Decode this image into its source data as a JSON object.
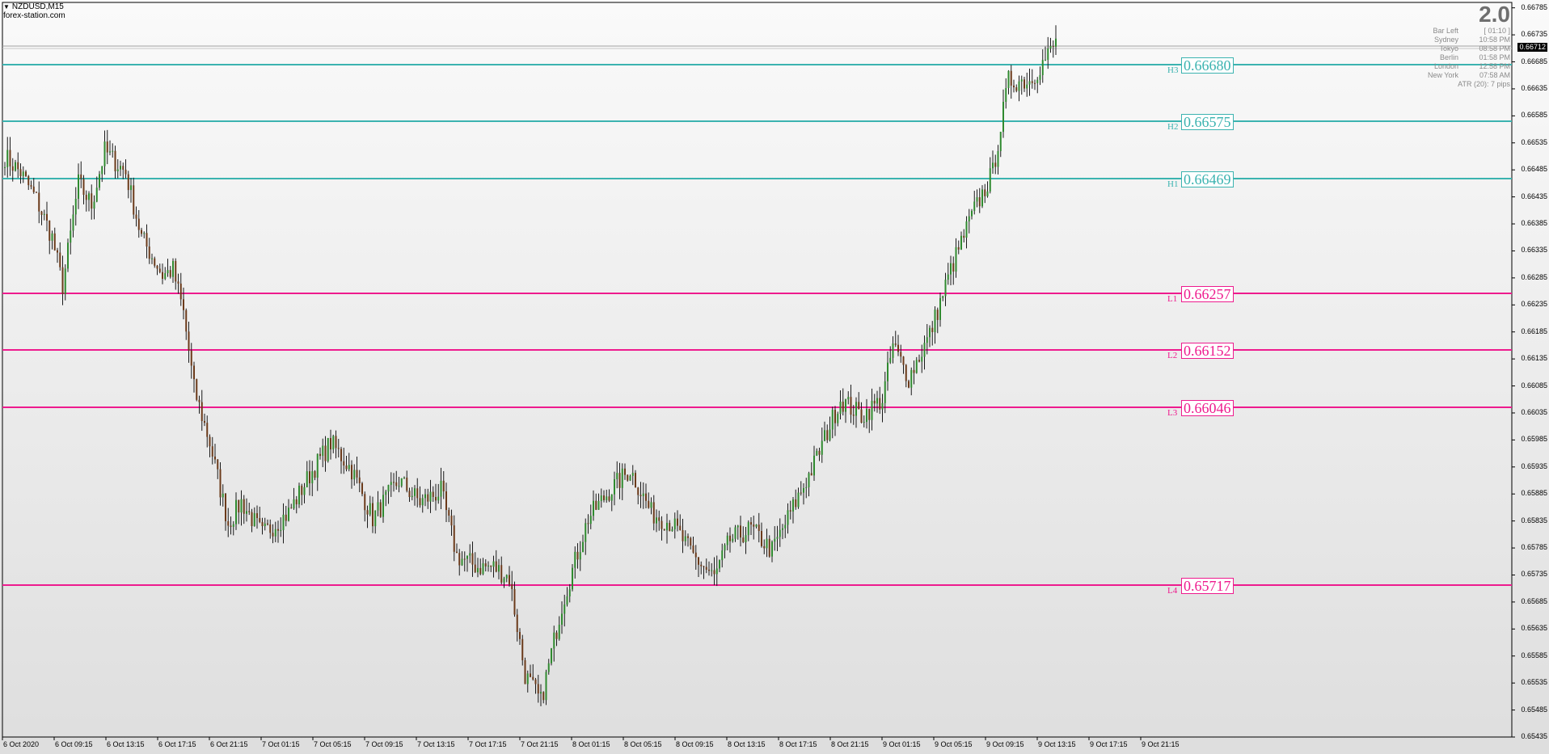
{
  "window": {
    "symbol": "NZDUSD,M15",
    "watermark": "forex-station.com"
  },
  "info_panel": {
    "version": "2.0",
    "rows": [
      {
        "label": "Bar Left",
        "value": "[ 01:10 ]"
      },
      {
        "label": "Sydney",
        "value": "10:58 PM"
      },
      {
        "label": "Tokyo",
        "value": "08:58 PM"
      },
      {
        "label": "Berlin",
        "value": "01:58 PM"
      },
      {
        "label": "London",
        "value": "12:58 PM"
      },
      {
        "label": "New York",
        "value": "07:58 AM"
      }
    ],
    "atr": "ATR (20): 7 pips"
  },
  "levels": [
    {
      "tag": "H3",
      "value": 0.6668,
      "text": "0.66680",
      "kind": "high"
    },
    {
      "tag": "H2",
      "value": 0.66575,
      "text": "0.66575",
      "kind": "high"
    },
    {
      "tag": "H1",
      "value": 0.66469,
      "text": "0.66469",
      "kind": "high"
    },
    {
      "tag": "L1",
      "value": 0.66257,
      "text": "0.66257",
      "kind": "low"
    },
    {
      "tag": "L2",
      "value": 0.66152,
      "text": "0.66152",
      "kind": "low"
    },
    {
      "tag": "L3",
      "value": 0.66046,
      "text": "0.66046",
      "kind": "low"
    },
    {
      "tag": "L4",
      "value": 0.65717,
      "text": "0.65717",
      "kind": "low"
    }
  ],
  "colors": {
    "high": "#3bb3b0",
    "low": "#ee1b8e",
    "bull": "#2f8a2f",
    "bear": "#6b3a1a",
    "wick": "#1a1a1a",
    "grid": "#a0a0a0"
  },
  "price_axis": {
    "ticks": [
      "0.66785",
      "0.66735",
      "0.66685",
      "0.66635",
      "0.66585",
      "0.66535",
      "0.66485",
      "0.66435",
      "0.66385",
      "0.66335",
      "0.66285",
      "0.66235",
      "0.66185",
      "0.66135",
      "0.66085",
      "0.66035",
      "0.65985",
      "0.65935",
      "0.65885",
      "0.65835",
      "0.65785",
      "0.65735",
      "0.65685",
      "0.65635",
      "0.65585",
      "0.65535",
      "0.65485",
      "0.65435"
    ],
    "current_price": "0.66712"
  },
  "time_axis": {
    "labels": [
      "6 Oct 2020",
      "6 Oct 09:15",
      "6 Oct 13:15",
      "6 Oct 17:15",
      "6 Oct 21:15",
      "7 Oct 01:15",
      "7 Oct 05:15",
      "7 Oct 09:15",
      "7 Oct 13:15",
      "7 Oct 17:15",
      "7 Oct 21:15",
      "8 Oct 01:15",
      "8 Oct 05:15",
      "8 Oct 09:15",
      "8 Oct 13:15",
      "8 Oct 17:15",
      "8 Oct 21:15",
      "9 Oct 01:15",
      "9 Oct 05:15",
      "9 Oct 09:15",
      "9 Oct 13:15",
      "9 Oct 17:15",
      "9 Oct 21:15"
    ]
  },
  "chart_data": {
    "type": "candlestick",
    "symbol": "NZDUSD",
    "timeframe": "M15",
    "ylim": [
      0.65435,
      0.66795
    ],
    "anchors": [
      [
        0,
        0.6651
      ],
      [
        6,
        0.6648
      ],
      [
        12,
        0.6643
      ],
      [
        18,
        0.6636
      ],
      [
        22,
        0.6627
      ],
      [
        28,
        0.6646
      ],
      [
        33,
        0.6642
      ],
      [
        38,
        0.6652
      ],
      [
        46,
        0.6648
      ],
      [
        52,
        0.6636
      ],
      [
        60,
        0.6629
      ],
      [
        64,
        0.663
      ],
      [
        68,
        0.6622
      ],
      [
        72,
        0.6608
      ],
      [
        78,
        0.6598
      ],
      [
        85,
        0.6583
      ],
      [
        90,
        0.6587
      ],
      [
        98,
        0.6581
      ],
      [
        108,
        0.6585
      ],
      [
        116,
        0.6592
      ],
      [
        124,
        0.6598
      ],
      [
        132,
        0.6593
      ],
      [
        140,
        0.6584
      ],
      [
        150,
        0.6591
      ],
      [
        158,
        0.6587
      ],
      [
        166,
        0.6589
      ],
      [
        172,
        0.6577
      ],
      [
        180,
        0.6575
      ],
      [
        186,
        0.6575
      ],
      [
        192,
        0.6573
      ],
      [
        198,
        0.6555
      ],
      [
        204,
        0.655
      ],
      [
        212,
        0.6568
      ],
      [
        222,
        0.6584
      ],
      [
        230,
        0.6589
      ],
      [
        238,
        0.6593
      ],
      [
        246,
        0.6585
      ],
      [
        254,
        0.6583
      ],
      [
        262,
        0.6577
      ],
      [
        270,
        0.6573
      ],
      [
        276,
        0.658
      ],
      [
        284,
        0.6582
      ],
      [
        292,
        0.6578
      ],
      [
        300,
        0.6586
      ],
      [
        308,
        0.6594
      ],
      [
        318,
        0.6606
      ],
      [
        326,
        0.6603
      ],
      [
        334,
        0.6606
      ],
      [
        338,
        0.6616
      ],
      [
        344,
        0.661
      ],
      [
        352,
        0.6618
      ],
      [
        360,
        0.663
      ],
      [
        368,
        0.664
      ],
      [
        376,
        0.6648
      ],
      [
        382,
        0.6665
      ],
      [
        390,
        0.6665
      ],
      [
        396,
        0.6669
      ],
      [
        400,
        0.6672
      ]
    ]
  }
}
